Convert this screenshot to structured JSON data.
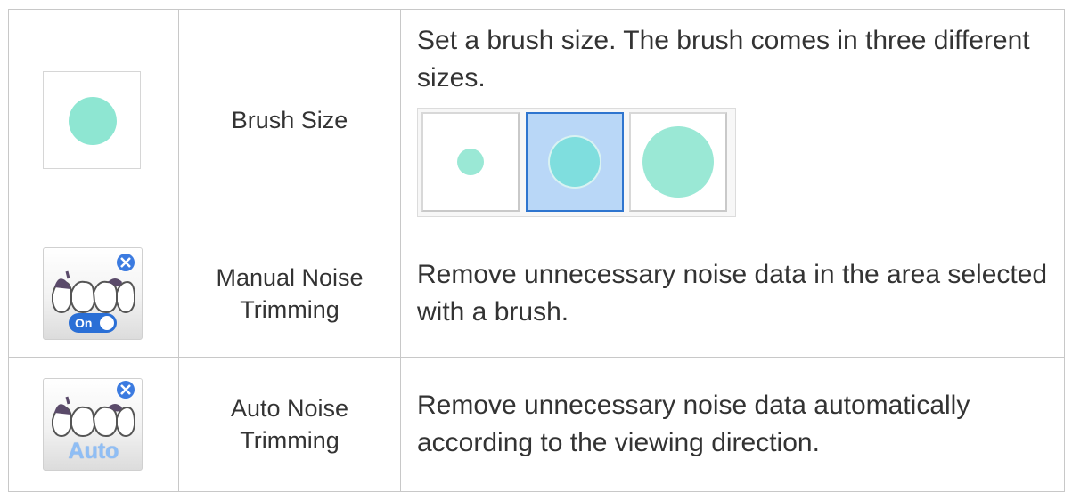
{
  "rows": [
    {
      "icon": "brush-size-icon",
      "name": "Brush Size",
      "description": "Set a brush size. The brush comes in three different sizes.",
      "size_options": [
        {
          "name": "small",
          "selected": false
        },
        {
          "name": "medium",
          "selected": true
        },
        {
          "name": "large",
          "selected": false
        }
      ]
    },
    {
      "icon": "manual-noise-trimming-icon",
      "name": "Manual Noise Trimming",
      "description": "Remove unnecessary noise data in the area selected with a brush.",
      "badge_label": "On"
    },
    {
      "icon": "auto-noise-trimming-icon",
      "name": "Auto Noise Trimming",
      "description": "Remove unnecessary noise data automatically according to the viewing direction.",
      "badge_label": "Auto"
    }
  ],
  "colors": {
    "brush": "#8ee6d2",
    "selected_fill": "#b9d7f7",
    "selected_border": "#2e75cf",
    "toggle_on": "#2a6fd6",
    "auto_text": "#8fbef5"
  }
}
